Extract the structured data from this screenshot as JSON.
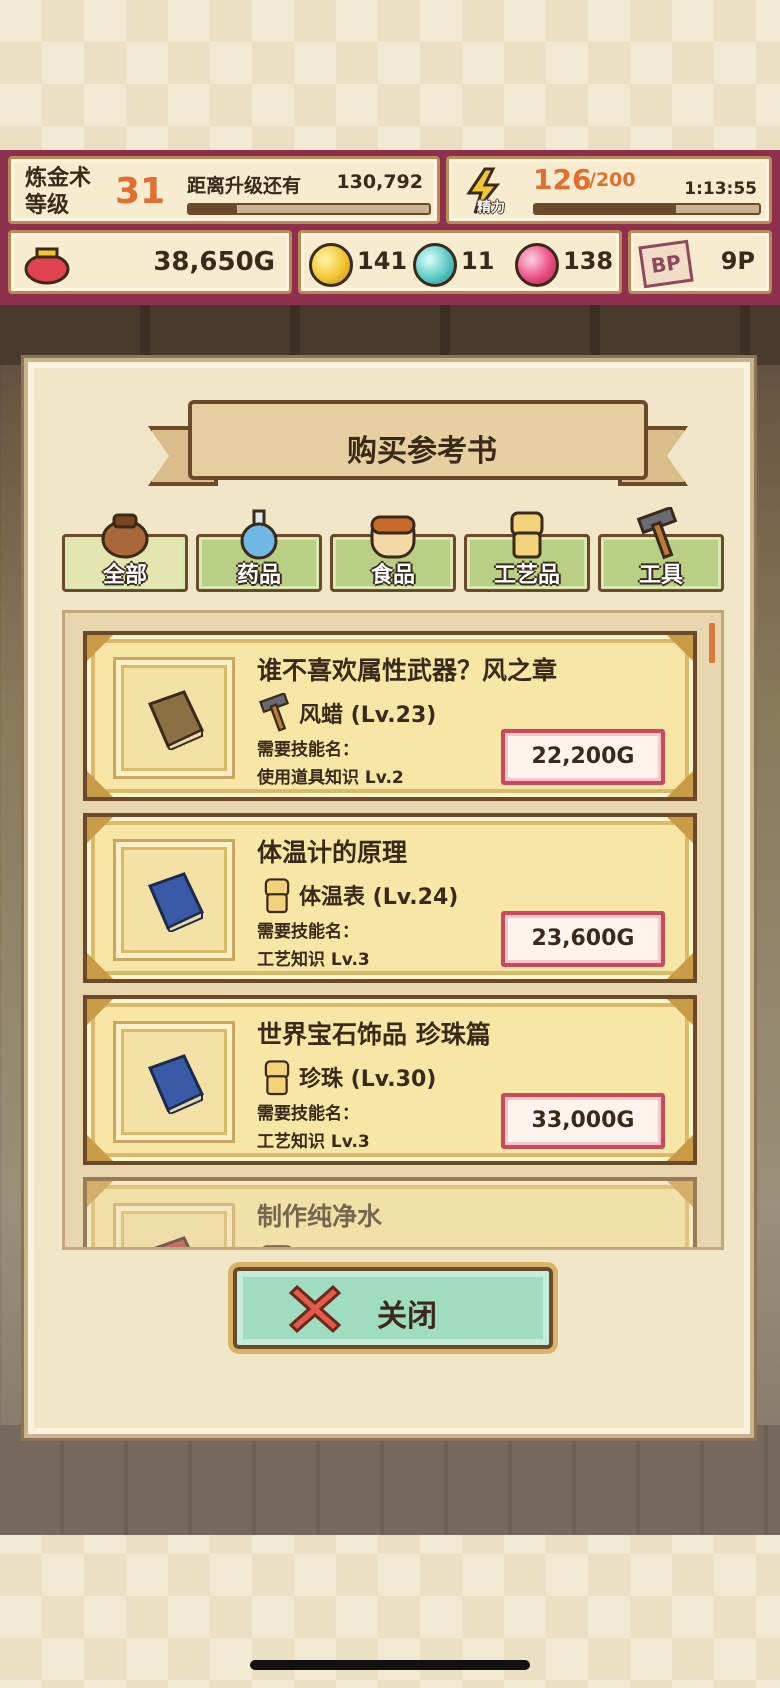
{
  "hud": {
    "level_title": "炼金术\n等级",
    "level": "31",
    "next_label": "距离升级还有",
    "next_value": "130,792",
    "level_progress": 0.2,
    "stamina_icon_label": "精力",
    "stamina_current": "126",
    "stamina_max": "/200",
    "stamina_timer": "1:13:55",
    "stamina_progress": 0.63,
    "gold": "38,650G",
    "gems": [
      {
        "name": "yellow-gem",
        "value": "141",
        "color": "#f2c534"
      },
      {
        "name": "teal-gem",
        "value": "11",
        "color": "#5cc9c4"
      },
      {
        "name": "pink-gem",
        "value": "138",
        "color": "#ea4f86"
      }
    ],
    "bp_icon": "BP",
    "bp_value": "9P"
  },
  "panel": {
    "title": "购买参考书",
    "tabs": [
      {
        "label": "全部",
        "icon": "bag-icon"
      },
      {
        "label": "药品",
        "icon": "potion-icon"
      },
      {
        "label": "食品",
        "icon": "bread-icon"
      },
      {
        "label": "工艺品",
        "icon": "figurine-icon"
      },
      {
        "label": "工具",
        "icon": "hammer-icon"
      }
    ],
    "items": [
      {
        "title": "谁不喜欢属性武器？风之章",
        "subject": "风蜡 (Lv.23)",
        "subject_icon": "hammer-icon",
        "req_label": "需要技能名：",
        "req": "使用道具知识 Lv.2",
        "price": "22,200G",
        "book_color": "brown"
      },
      {
        "title": "体温计的原理",
        "subject": "体温表 (Lv.24)",
        "subject_icon": "figurine-icon",
        "req_label": "需要技能名：",
        "req": "工艺知识 Lv.3",
        "price": "23,600G",
        "book_color": "blue"
      },
      {
        "title": "世界宝石饰品 珍珠篇",
        "subject": "珍珠 (Lv.30)",
        "subject_icon": "figurine-icon",
        "req_label": "需要技能名：",
        "req": "工艺知识 Lv.3",
        "price": "33,000G",
        "book_color": "blue"
      },
      {
        "title": "制作纯净水",
        "subject": "",
        "subject_icon": "bread-icon",
        "req_label": "",
        "req": "",
        "price": "",
        "book_color": "red"
      }
    ],
    "close_label": "关闭"
  }
}
